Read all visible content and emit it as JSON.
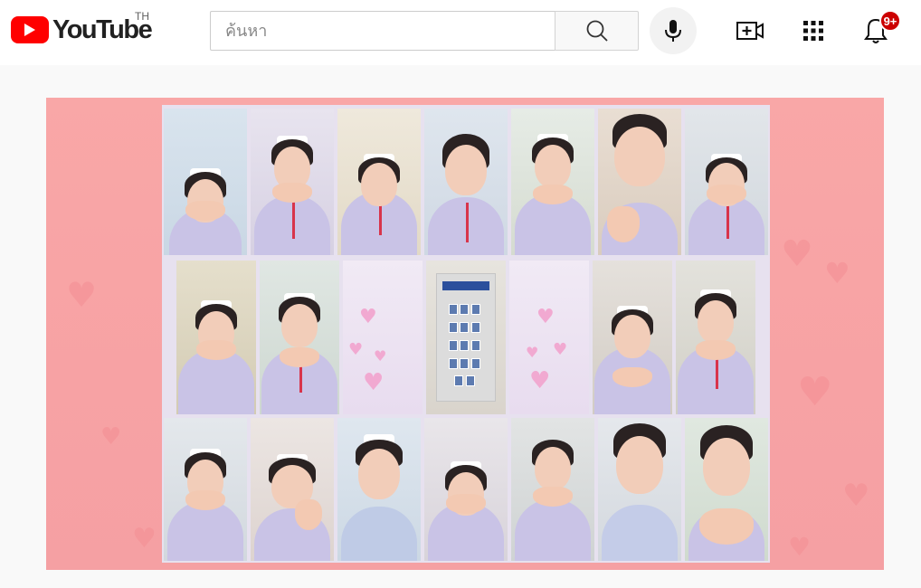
{
  "header": {
    "logo_text": "YouTube",
    "region_code": "TH",
    "search_placeholder": "ค้นหา",
    "notification_count": "9+"
  },
  "icons": {
    "search": "search-icon",
    "mic": "microphone-icon",
    "create": "create-video-icon",
    "apps": "apps-grid-icon",
    "notifications": "bell-icon"
  },
  "colors": {
    "brand_red": "#ff0000",
    "badge_red": "#cc0000",
    "thumbnail_pink": "#f9a7a7",
    "uniform_lavender": "#c9c3e6"
  }
}
